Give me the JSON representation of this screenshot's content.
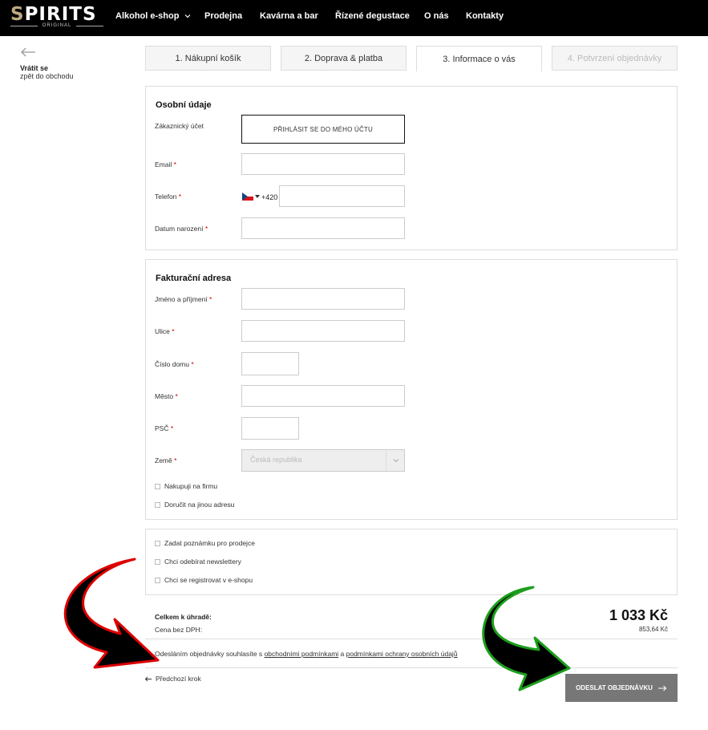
{
  "brand": {
    "logo_main": "SPIRITS",
    "logo_sub": "ORIGINAL"
  },
  "nav": [
    {
      "label": "Alkohol e-shop",
      "has_dropdown": true
    },
    {
      "label": "Prodejna"
    },
    {
      "label": "Kavárna a bar"
    },
    {
      "label": "Řízené degustace"
    },
    {
      "label": "O nás"
    },
    {
      "label": "Kontakty"
    }
  ],
  "back": {
    "title": "Vrátit se",
    "subtitle": "zpět do obchodu"
  },
  "steps": [
    {
      "label": "1. Nákupní košík",
      "state": "done"
    },
    {
      "label": "2. Doprava & platba",
      "state": "done"
    },
    {
      "label": "3. Informace o vás",
      "state": "active"
    },
    {
      "label": "4. Potvrzení objednávky",
      "state": "disabled"
    }
  ],
  "personal": {
    "title": "Osobní údaje",
    "account_label": "Zákaznický účet",
    "login_button": "PŘIHLÁSIT SE DO MÉHO ÚČTU",
    "email_label": "Email",
    "phone_label": "Telefon",
    "phone_prefix": "+420",
    "birth_label": "Datum narození",
    "required_mark": "*"
  },
  "billing": {
    "title": "Fakturační adresa",
    "name_label": "Jméno a příjmení",
    "street_label": "Ulice",
    "house_label": "Číslo domu",
    "city_label": "Město",
    "zip_label": "PSČ",
    "country_label": "Země",
    "country_value": "Česká republika",
    "company_check": "Nakupuji na firmu",
    "other_address_check": "Doručit na jinou adresu"
  },
  "extras": {
    "note_check": "Zadat poznámku pro prodejce",
    "newsletter_check": "Chci odebírat newslettery",
    "register_check": "Chci se registrovat v e-shopu"
  },
  "summary": {
    "total_label": "Celkem k úhradě:",
    "net_label": "Cena bez DPH:",
    "total_value": "1 033 Kč",
    "net_value": "853,64 Kč"
  },
  "agreement": {
    "prefix": "Odesláním objednávky souhlasíte s ",
    "terms_link": "obchodními podmínkami",
    "middle": " a ",
    "privacy_link": "podmínkami ochrany osobních údajů"
  },
  "actions": {
    "prev_label": "Předchozí krok",
    "submit_label": "ODESLAT OBJEDNÁVKU"
  },
  "colors": {
    "topbar": "#000000",
    "brand_accent": "#bfa982",
    "submit_bg": "#777777",
    "required": "#cc0000"
  }
}
